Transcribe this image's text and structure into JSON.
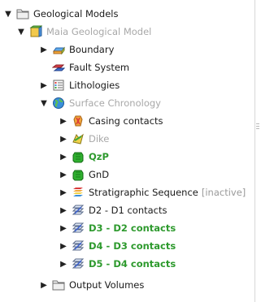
{
  "tree": {
    "root": {
      "label": "Geological Models",
      "icon": "folder-icon",
      "expanded": true
    },
    "model": {
      "label": "Maia Geological Model",
      "icon": "model-icon",
      "expanded": true
    },
    "boundary": {
      "label": "Boundary",
      "icon": "boundary-icon"
    },
    "fault_system": {
      "label": "Fault System",
      "icon": "fault-system-icon"
    },
    "lithologies": {
      "label": "Lithologies",
      "icon": "lithologies-icon"
    },
    "surface_chronology": {
      "label": "Surface Chronology",
      "icon": "globe-icon",
      "expanded": true
    },
    "casing_contacts": {
      "label": "Casing contacts",
      "icon": "casing-icon"
    },
    "dike": {
      "label": "Dike",
      "icon": "dike-icon"
    },
    "qzp": {
      "label": "QzP",
      "icon": "green-unit-icon"
    },
    "gnd": {
      "label": "GnD",
      "icon": "green-unit-icon"
    },
    "strat_sequence": {
      "label": "Stratigraphic Sequence",
      "status": "[inactive]",
      "icon": "strat-sequence-icon"
    },
    "d2_d1": {
      "label": "D2 - D1 contacts",
      "icon": "contacts-icon"
    },
    "d3_d2": {
      "label": "D3 - D2 contacts",
      "icon": "contacts-icon"
    },
    "d4_d3": {
      "label": "D4 - D3 contacts",
      "icon": "contacts-icon"
    },
    "d5_d4": {
      "label": "D5 - D4 contacts",
      "icon": "contacts-icon"
    },
    "output_volumes": {
      "label": "Output Volumes",
      "icon": "folder-icon"
    }
  },
  "colors": {
    "active_green": "#2e9a2e",
    "muted_text": "#a8a8a8",
    "inactive_text": "#9a9a9a"
  }
}
